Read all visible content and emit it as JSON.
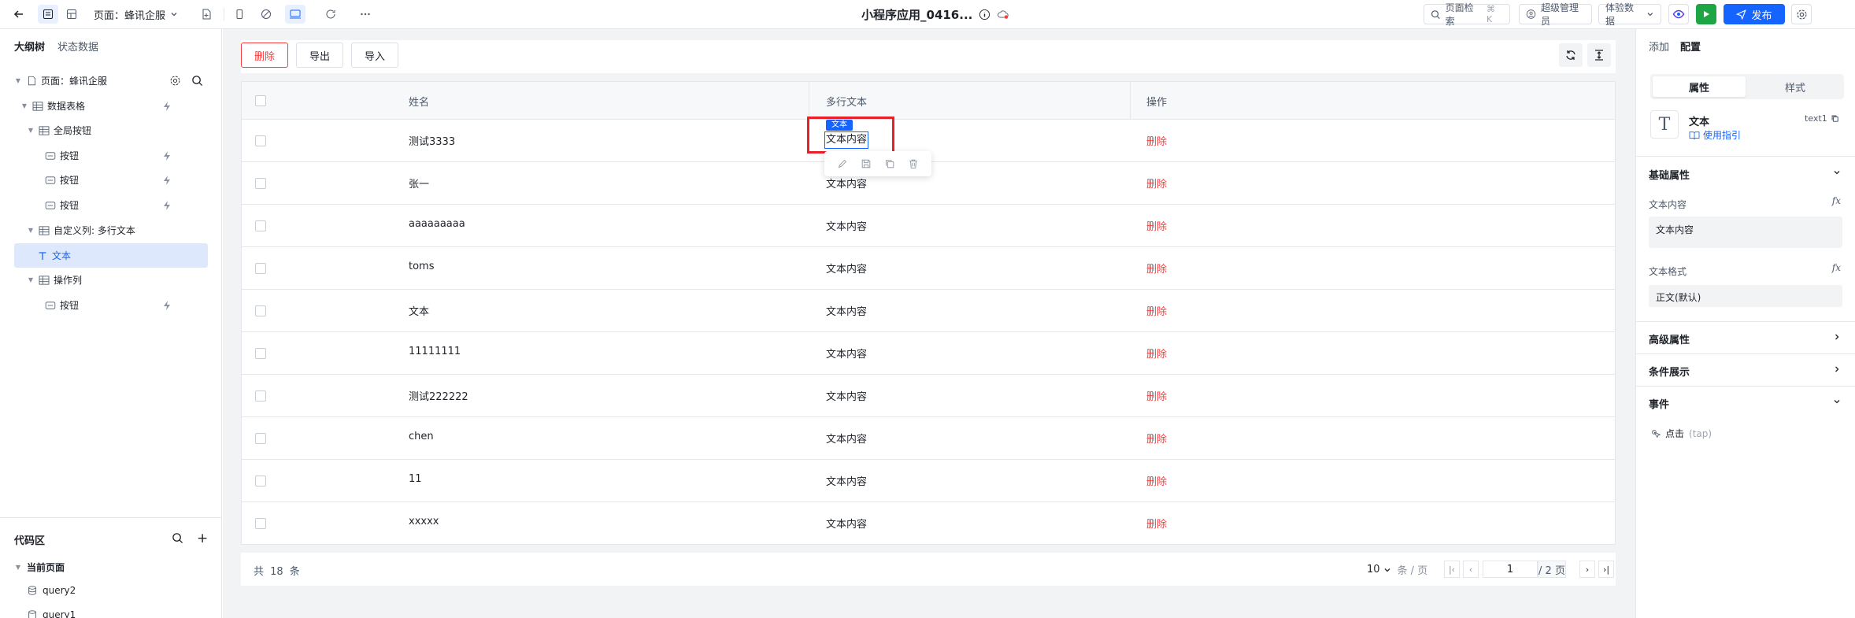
{
  "topbar": {
    "page_select": "页面：蜂讯企服",
    "app_title": "小程序应用_0416...",
    "search_label": "页面检索",
    "search_shortcut": "⌘ K",
    "user_role": "超级管理员",
    "data_mode": "体验数据",
    "publish_label": "发布"
  },
  "left": {
    "tabs": [
      "大纲树",
      "状态数据"
    ],
    "tree": [
      {
        "label": "页面：蜂讯企服",
        "icon": "page-icon"
      },
      {
        "label": "数据表格",
        "icon": "table-icon"
      },
      {
        "label": "全局按钮",
        "icon": "table-icon"
      },
      {
        "label": "按钮",
        "icon": "button-icon"
      },
      {
        "label": "按钮",
        "icon": "button-icon"
      },
      {
        "label": "按钮",
        "icon": "button-icon"
      },
      {
        "label": "自定义列: 多行文本",
        "icon": "table-icon"
      },
      {
        "label": "文本",
        "icon": "text-icon"
      },
      {
        "label": "操作列",
        "icon": "table-icon"
      },
      {
        "label": "按钮",
        "icon": "button-icon"
      }
    ],
    "code": {
      "title": "代码区",
      "section": "当前页面",
      "items": [
        "query2",
        "query1"
      ]
    }
  },
  "canvas": {
    "toolbar": {
      "delete": "删除",
      "export": "导出",
      "import": "导入"
    },
    "table": {
      "headers": [
        "姓名",
        "多行文本",
        "操作"
      ],
      "rows": [
        {
          "name": "测试3333",
          "text": "文本内容",
          "action": "删除"
        },
        {
          "name": "张一",
          "text": "文本内容",
          "action": "删除"
        },
        {
          "name": "aaaaaaaaa",
          "text": "文本内容",
          "action": "删除"
        },
        {
          "name": "toms",
          "text": "文本内容",
          "action": "删除"
        },
        {
          "name": "文本",
          "text": "文本内容",
          "action": "删除"
        },
        {
          "name": "11111111",
          "text": "文本内容",
          "action": "删除"
        },
        {
          "name": "测试222222",
          "text": "文本内容",
          "action": "删除"
        },
        {
          "name": "chen",
          "text": "文本内容",
          "action": "删除"
        },
        {
          "name": "11",
          "text": "文本内容",
          "action": "删除"
        },
        {
          "name": "xxxxx",
          "text": "文本内容",
          "action": "删除"
        }
      ]
    },
    "selection": {
      "tag": "文本",
      "text": "文本内容"
    },
    "pager": {
      "total": "共 18 条",
      "page_size": "10",
      "page_size_unit": "条 / 页",
      "current_page": "1",
      "page_of": "/ 2 页"
    }
  },
  "right": {
    "tabs": [
      "添加",
      "配置"
    ],
    "segment": [
      "属性",
      "样式"
    ],
    "component": {
      "icon_glyph": "T",
      "name": "文本",
      "guide": "使用指引",
      "id": "text1"
    },
    "sections": {
      "basic": "基础属性",
      "advanced": "高级属性",
      "conditional": "条件展示",
      "events": "事件"
    },
    "props": {
      "text_content_label": "文本内容",
      "text_content_value": "文本内容",
      "text_format_label": "文本格式",
      "text_format_value": "正文(默认)",
      "fx": "fx"
    },
    "event": {
      "label": "点击",
      "hint": "(tap)"
    }
  },
  "colors": {
    "accent": "#1664ff",
    "danger": "#f53f3f",
    "run": "#1fa644",
    "selection_outline": "#e8202a"
  }
}
